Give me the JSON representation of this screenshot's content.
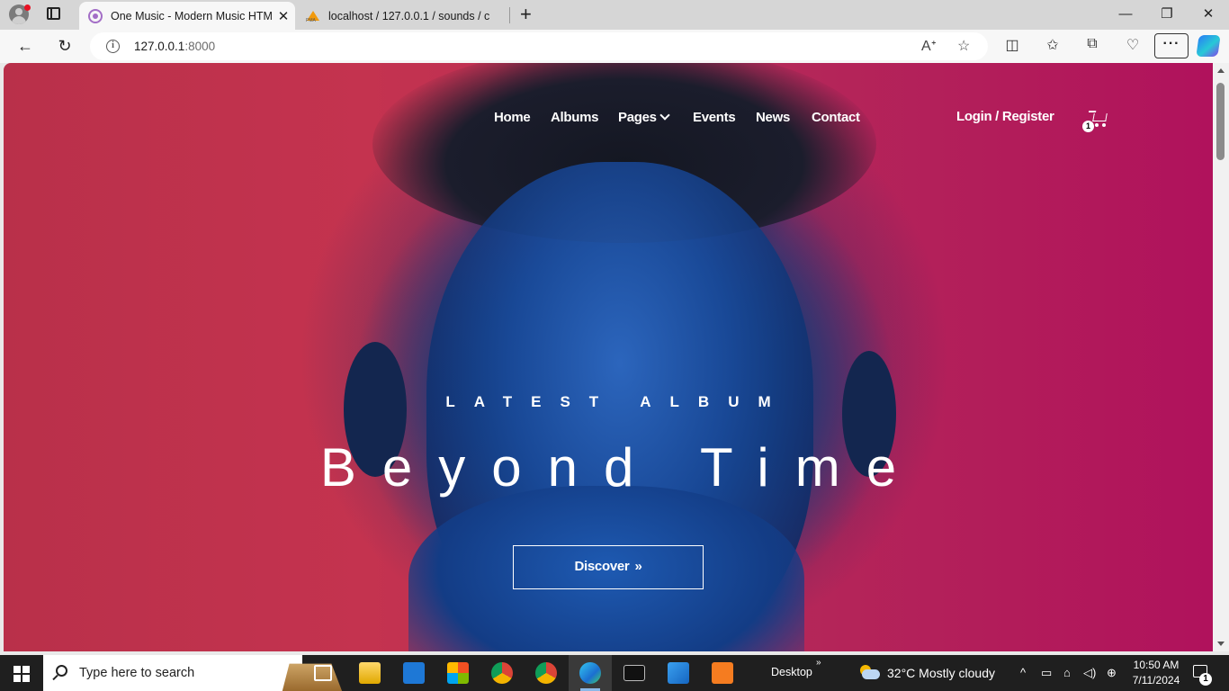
{
  "browser": {
    "tabs": [
      {
        "title": "One Music - Modern Music HTML",
        "icon": "music-site-favicon",
        "active": true
      },
      {
        "title": "localhost / 127.0.0.1 / sounds / c",
        "icon": "phpmyadmin-favicon",
        "active": false
      }
    ],
    "close_glyph": "✕",
    "new_tab_glyph": "+",
    "address": {
      "host": "127.0.0.1",
      "port": ":8000"
    },
    "window_controls": {
      "minimize": "—",
      "maximize": "❐",
      "close": "✕"
    },
    "menu_glyph": "···"
  },
  "site": {
    "nav": {
      "home": "Home",
      "albums": "Albums",
      "pages": "Pages",
      "events": "Events",
      "news": "News",
      "contact": "Contact",
      "login": "Login / Register",
      "cart_count": "1"
    },
    "hero": {
      "kicker": "LATEST ALBUM",
      "title": "Beyond Time",
      "button": "Discover",
      "button_arrow": "»"
    }
  },
  "taskbar": {
    "search_placeholder": "Type here to search",
    "desktop_label": "Desktop",
    "desktop_chevron": "»",
    "weather": "32°C  Mostly cloudy",
    "time": "10:50 AM",
    "date": "7/11/2024",
    "notifications": "1",
    "tray_up": "^"
  },
  "colors": {
    "accent_edge": "#0a84d6",
    "chrome_bg": "#f7f7f7",
    "taskbar_bg": "#1f1f1f"
  }
}
